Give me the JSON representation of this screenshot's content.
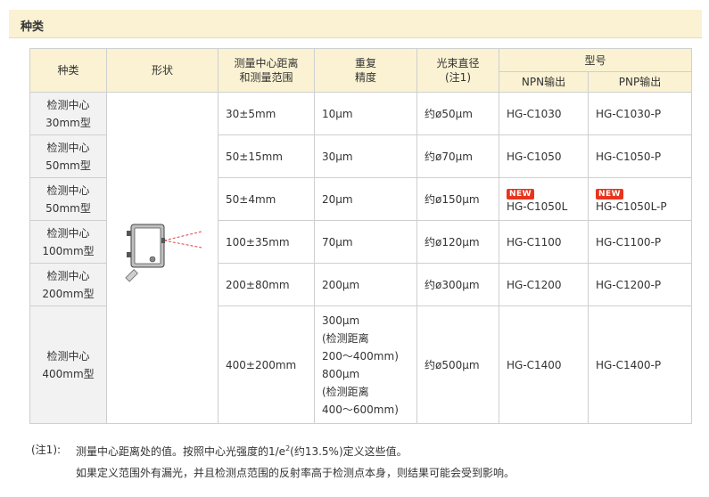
{
  "section_title": "种类",
  "headers": {
    "type": "种类",
    "shape": "形状",
    "distance": [
      "测量中心距离",
      "和测量范围"
    ],
    "precision": [
      "重复",
      "精度"
    ],
    "beam": [
      "光束直径",
      "(注1)"
    ],
    "model": "型号",
    "npn": "NPN输出",
    "pnp": "PNP输出"
  },
  "badge_text": "NEW",
  "rows": [
    {
      "type": [
        "检测中心",
        "30mm型"
      ],
      "distance": "30±5mm",
      "precision": [
        "10μm"
      ],
      "beam": "约ø50μm",
      "npn": "HG-C1030",
      "pnp": "HG-C1030-P",
      "new": false
    },
    {
      "type": [
        "检测中心",
        "50mm型"
      ],
      "distance": "50±15mm",
      "precision": [
        "30μm"
      ],
      "beam": "约ø70μm",
      "npn": "HG-C1050",
      "pnp": "HG-C1050-P",
      "new": false
    },
    {
      "type": [
        "检测中心",
        "50mm型"
      ],
      "distance": "50±4mm",
      "precision": [
        "20μm"
      ],
      "beam": "约ø150μm",
      "npn": "HG-C1050L",
      "pnp": "HG-C1050L-P",
      "new": true
    },
    {
      "type": [
        "检测中心",
        "100mm型"
      ],
      "distance": "100±35mm",
      "precision": [
        "70μm"
      ],
      "beam": "约ø120μm",
      "npn": "HG-C1100",
      "pnp": "HG-C1100-P",
      "new": false
    },
    {
      "type": [
        "检测中心",
        "200mm型"
      ],
      "distance": "200±80mm",
      "precision": [
        "200μm"
      ],
      "beam": "约ø300μm",
      "npn": "HG-C1200",
      "pnp": "HG-C1200-P",
      "new": false
    },
    {
      "type": [
        "检测中心",
        "400mm型"
      ],
      "distance": "400±200mm",
      "precision": [
        "300μm",
        "(检测距离",
        "200～400mm)",
        "800μm",
        "(检测距离",
        "400～600mm)"
      ],
      "beam": "约ø500μm",
      "npn": "HG-C1400",
      "pnp": "HG-C1400-P",
      "new": false
    }
  ],
  "notes": {
    "label": "(注1):",
    "line1_pre": "测量中心距离处的值。按照中心光强度的1/e",
    "line1_sup": "2",
    "line1_post": "(约13.5%)定义这些值。",
    "line2": "如果定义范围外有漏光，并且检测点范围的反射率高于检测点本身，则结果可能会受到影响。"
  },
  "colors": {
    "header_bg": "#faf2d3",
    "type_bg": "#f2f2f2",
    "badge": "#e8341c",
    "laser": "#e04040"
  },
  "icons": {
    "sensor": "sensor-device-icon"
  }
}
